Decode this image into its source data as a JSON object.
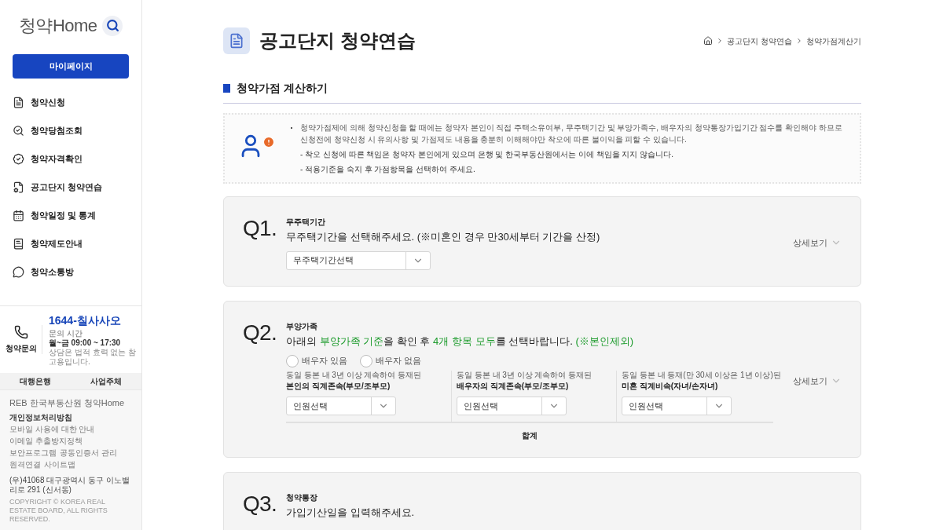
{
  "sidebar": {
    "logo": "청약Home",
    "mypage_button": "마이페이지",
    "menu": [
      {
        "label": "청약신청"
      },
      {
        "label": "청약당첨조회"
      },
      {
        "label": "청약자격확인"
      },
      {
        "label": "공고단지 청약연습"
      },
      {
        "label": "청약일정 및 통계"
      },
      {
        "label": "청약제도안내"
      },
      {
        "label": "청약소통방"
      }
    ],
    "contact": {
      "label": "청약문의",
      "phone": "1644-칠사사오",
      "hours_label": "문의 시간",
      "hours": "월~금 09:00 ~ 17:30",
      "note": "상담은 법적 효력 없는 참고용입니다."
    },
    "tabs": [
      "대행은행",
      "사업주체"
    ],
    "footer_logo": "REB 한국부동산원 청약Home",
    "footer_links": [
      {
        "label": "개인정보처리방침",
        "bold": true
      },
      {
        "label": "모바일 사용에 대한 안내",
        "bold": false
      },
      {
        "label": "이메일 추출방지정책",
        "bold": false
      },
      {
        "label": "보안프로그램",
        "bold": false
      },
      {
        "label": "공동인증서 관리",
        "bold": false
      },
      {
        "label": "원격연결",
        "bold": false
      },
      {
        "label": "사이트맵",
        "bold": false
      }
    ],
    "address": "(우)41068 대구광역시 동구 이노밸리로 291 (신서동)",
    "copyright": "COPYRIGHT © KOREA REAL ESTATE BOARD, ALL RIGHTS RESERVED."
  },
  "page": {
    "title": "공고단지 청약연습",
    "breadcrumb": [
      "공고단지 청약연습",
      "청약가점계산기"
    ],
    "section_title": "청약가점 계산하기",
    "notice": {
      "main": "청약가점제에 의해 청약신청을 할 때에는 청약자 본인이 직접 주택소유여부, 무주택기간 및 부양가족수, 배우자의 청약통장가입기간 점수를 확인해야 하므로 신청전에 청약신청 시 유의사항 및 가점제도 내용을 충분히 이해해야만 착오에 따른 불이익을 피할 수 있습니다.",
      "subs": [
        "- 착오 신청에 따른 책임은 청약자 본인에게 있으며 은행 및 한국부동산원에서는 이에 책임을 지지 않습니다.",
        "- 적용기준을 숙지 후 가점항목을 선택하여 주세요."
      ]
    },
    "questions": [
      {
        "number": "Q1.",
        "label": "무주택기간",
        "text": "무주택기간을 선택해주세요. (※미혼인 경우 만30세부터 기간을 산정)",
        "detail": "상세보기",
        "kind": "select",
        "select": "무주택기간선택"
      },
      {
        "number": "Q2.",
        "label": "부양가족",
        "text": "아래의 **부양가족 기준**을 확인 후 **4개 항목 모두**를 선택바랍니다. **(※본인제외)**",
        "detail": "상세보기",
        "kind": "family",
        "radios": [
          {
            "label": "배우자 있음",
            "selected": false
          },
          {
            "label": "배우자 없음",
            "selected": false
          }
        ],
        "groups": [
          {
            "hint": "동일 등본 내 3년 이상 계속하여 등재된",
            "title": "본인의 직계존속(부모/조부모)",
            "select": "인원선택"
          },
          {
            "hint": "동일 등본 내 3년 이상 계속하여 등재된",
            "title": "배우자의 직계존속(부모/조부모)",
            "select": "인원선택"
          },
          {
            "hint": "동일 등본 내 등재(만 30세 이상은 1년 이상)된",
            "title": "미혼 직계비속(자녀/손자녀)",
            "select": "인원선택"
          }
        ],
        "total": "합계"
      },
      {
        "number": "Q3.",
        "label": "청약통장",
        "text": "가입기산일을 입력해주세요.",
        "kind": "partial"
      }
    ]
  }
}
